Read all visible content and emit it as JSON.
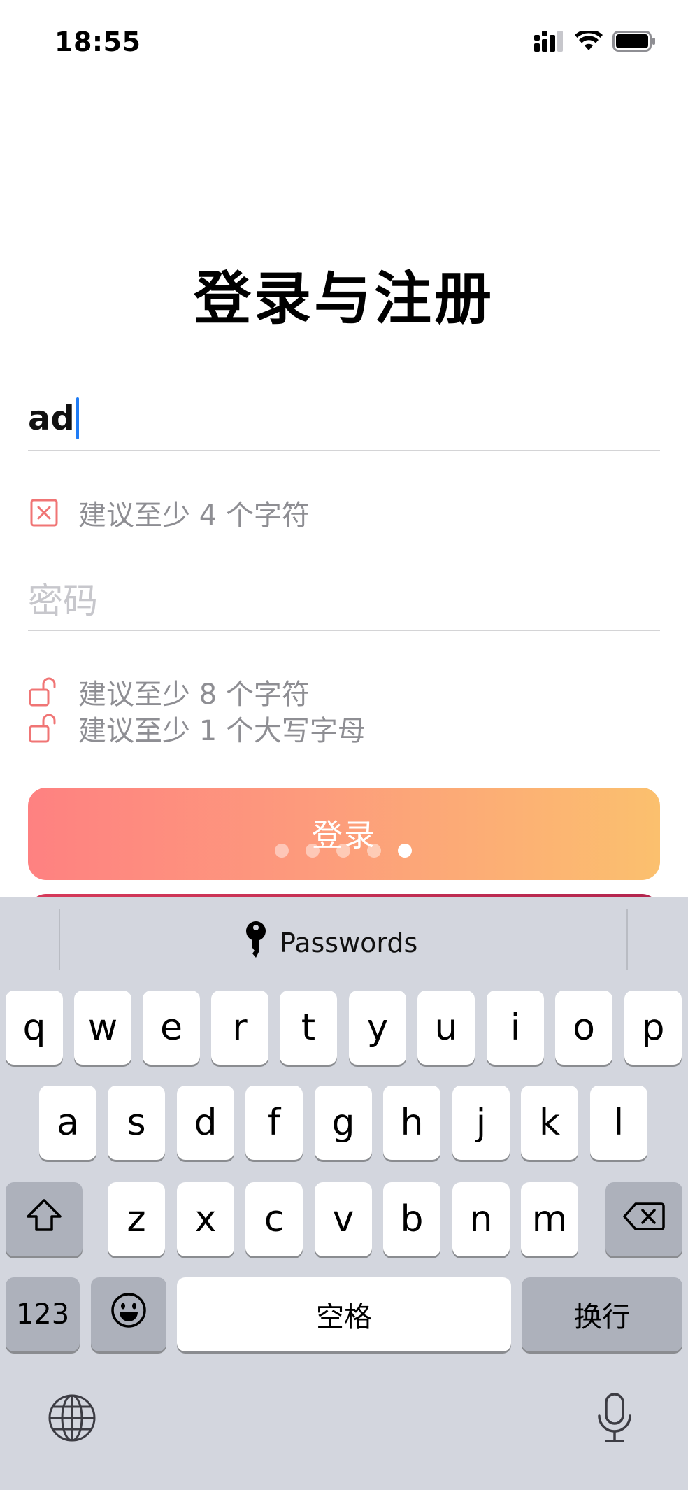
{
  "status_bar": {
    "time": "18:55"
  },
  "login": {
    "title": "登录与注册",
    "username_value": "ad",
    "username_hint": "建议至少 4 个字符",
    "password_placeholder": "密码",
    "password_hints": [
      "建议至少 8 个字符",
      "建议至少 1 个大写字母"
    ],
    "login_button": "登录"
  },
  "keyboard": {
    "passwords_label": "Passwords",
    "row1": [
      "q",
      "w",
      "e",
      "r",
      "t",
      "y",
      "u",
      "i",
      "o",
      "p"
    ],
    "row2": [
      "a",
      "s",
      "d",
      "f",
      "g",
      "h",
      "j",
      "k",
      "l"
    ],
    "row3": [
      "z",
      "x",
      "c",
      "v",
      "b",
      "n",
      "m"
    ],
    "numbers_label": "123",
    "space_label": "空格",
    "return_label": "换行"
  },
  "colors": {
    "accent_caret": "#1f7cf5",
    "button_gradient_start": "#fe8181",
    "button_gradient_end": "#fbc06e",
    "hint_icon_red": "#f07575"
  }
}
